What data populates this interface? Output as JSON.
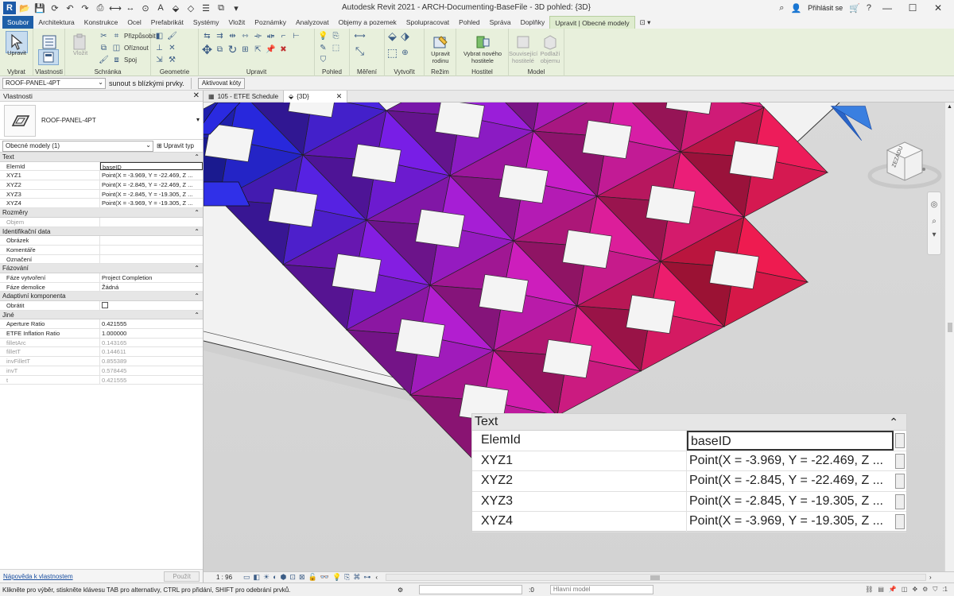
{
  "title_bar": {
    "window_title": "Autodesk Revit 2021 - ARCH-Documenting-BaseFile - 3D pohled: {3D}",
    "sign_in": "Přihlásit se",
    "app_logo": "R"
  },
  "menu_tabs": [
    "Soubor",
    "Architektura",
    "Konstrukce",
    "Ocel",
    "Prefabrikát",
    "Systémy",
    "Vložit",
    "Poznámky",
    "Analyzovat",
    "Objemy a pozemek",
    "Spolupracovat",
    "Pohled",
    "Správa",
    "Doplňky",
    "Upravit | Obecné modely"
  ],
  "ribbon": {
    "modify_label": "Upravit",
    "properties_label": "Vlastnosti",
    "paste_label": "Vložit",
    "cope_label": "Přizpůsobit",
    "cut_label": "Oříznout",
    "join_label": "Spoj",
    "edit_family_label": "Upravit rodinu",
    "pick_host_label": "Vybrat nového hostitele",
    "related_hosts_label": "Související hostitelé",
    "in_place_label": "Podlaží objemu",
    "groups": {
      "select": "Vybrat",
      "properties": "Vlastnosti",
      "clipboard": "Schránka",
      "geometry": "Geometrie",
      "modify": "Upravit",
      "view": "Pohled",
      "measure": "Měření",
      "create": "Vytvořit",
      "mode": "Režim",
      "host": "Hostitel",
      "model": "Model"
    }
  },
  "options_bar": {
    "type_selector": "ROOF-PANEL-4PT",
    "hint": "sunout s blízkými prvky.",
    "activate_dims": "Aktivovat kóty"
  },
  "properties": {
    "panel_title": "Vlastnosti",
    "type_name": "ROOF-PANEL-4PT",
    "filter": "Obecné modely (1)",
    "edit_type": "Upravit typ",
    "sections": [
      {
        "name": "Text",
        "rows": [
          {
            "k": "ElemId",
            "v": "baseID",
            "box": true
          },
          {
            "k": "XYZ1",
            "v": "Point(X = -3.969, Y = -22.469, Z ..."
          },
          {
            "k": "XYZ2",
            "v": "Point(X = -2.845, Y = -22.469, Z ..."
          },
          {
            "k": "XYZ3",
            "v": "Point(X = -2.845, Y = -19.305, Z ..."
          },
          {
            "k": "XYZ4",
            "v": "Point(X = -3.969, Y = -19.305, Z ..."
          }
        ]
      },
      {
        "name": "Rozměry",
        "rows": [
          {
            "k": "Objem",
            "v": "",
            "dim": true
          }
        ]
      },
      {
        "name": "Identifikační data",
        "rows": [
          {
            "k": "Obrázek",
            "v": ""
          },
          {
            "k": "Komentáře",
            "v": ""
          },
          {
            "k": "Označení",
            "v": ""
          }
        ]
      },
      {
        "name": "Fázování",
        "rows": [
          {
            "k": "Fáze vytvoření",
            "v": "Project Completion"
          },
          {
            "k": "Fáze demolice",
            "v": "Žádná"
          }
        ]
      },
      {
        "name": "Adaptivní komponenta",
        "rows": [
          {
            "k": "Obrátit",
            "v": "",
            "check": true
          }
        ]
      },
      {
        "name": "Jiné",
        "rows": [
          {
            "k": "Aperture Ratio",
            "v": "0.421555"
          },
          {
            "k": "ETFE Inflation Ratio",
            "v": "1.000000"
          },
          {
            "k": "filletArc",
            "v": "0.143165",
            "dim": true
          },
          {
            "k": "filletT",
            "v": "0.144611",
            "dim": true
          },
          {
            "k": "invFilletT",
            "v": "0.855389",
            "dim": true
          },
          {
            "k": "invT",
            "v": "0.578445",
            "dim": true
          },
          {
            "k": "t",
            "v": "0.421555",
            "dim": true
          }
        ]
      }
    ],
    "help_link": "Nápověda k vlastnostem",
    "apply": "Použít"
  },
  "view_tabs": [
    {
      "label": "105 - ETFE Schedule",
      "active": false
    },
    {
      "label": "{3D}",
      "active": true
    }
  ],
  "viewcube_label": "ZEZADU",
  "zoom_panel": {
    "section": "Text",
    "rows": [
      {
        "k": "ElemId",
        "v": "baseID",
        "box": true
      },
      {
        "k": "XYZ1",
        "v": "Point(X = -3.969, Y = -22.469, Z ..."
      },
      {
        "k": "XYZ2",
        "v": "Point(X = -2.845, Y = -22.469, Z ..."
      },
      {
        "k": "XYZ3",
        "v": "Point(X = -2.845, Y = -19.305, Z ..."
      },
      {
        "k": "XYZ4",
        "v": "Point(X = -3.969, Y = -19.305, Z ..."
      }
    ]
  },
  "view_bar": {
    "scale": "1 : 96"
  },
  "status_bar": {
    "message": "Klikněte pro výběr, stiskněte klávesu TAB pro alternativy, CTRL pro přidání, SHIFT pro odebrání prvků.",
    "zero": ":0",
    "model": "Hlavní model",
    "filter_count": ":1"
  }
}
